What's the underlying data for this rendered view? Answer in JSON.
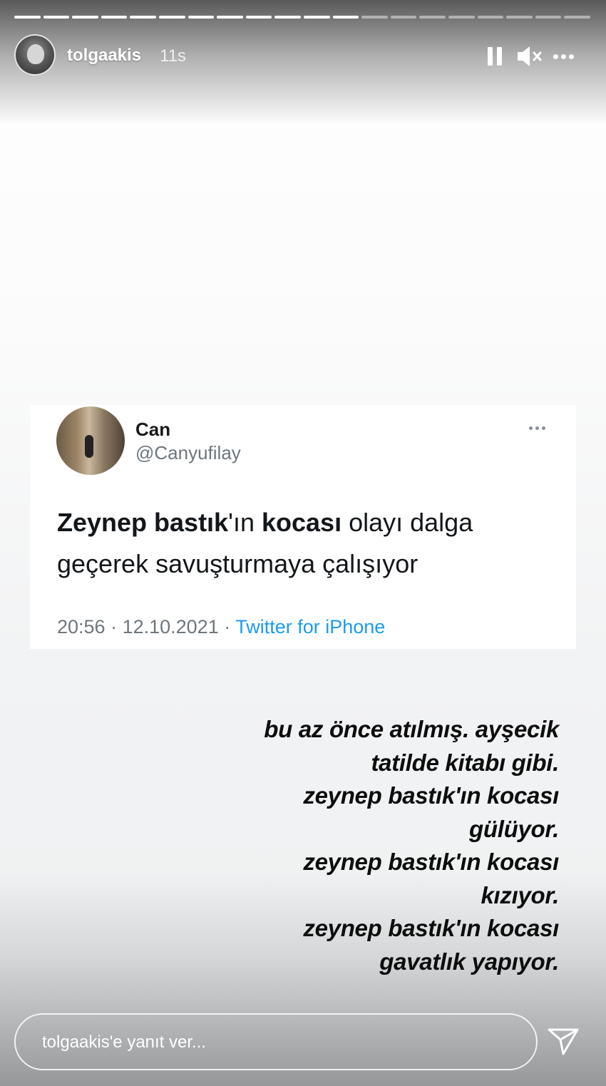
{
  "story": {
    "progress": {
      "segments": 20,
      "completed": 12
    }
  },
  "header": {
    "username": "tolgaakis",
    "time": "11s",
    "icons": [
      "pause-icon",
      "mute-icon",
      "more-icon"
    ]
  },
  "tweet": {
    "name": "Can",
    "handle": "@Canyufilay",
    "text_parts": {
      "p1": "Zeynep bastık",
      "p2": "'ın ",
      "p3": "kocası",
      "p4": " olayı dalga geçerek savuşturmaya çalışıyor"
    },
    "time": "20:56",
    "date": "12.10.2021",
    "source": "Twitter for iPhone",
    "separator": " · "
  },
  "caption": {
    "lines": [
      "bu az önce atılmış. ayşecik",
      "tatilde kitabı gibi.",
      "zeynep bastık'ın kocası",
      "gülüyor.",
      "zeynep bastık'ın kocası",
      "kızıyor.",
      "zeynep bastık'ın kocası",
      "gavatlık yapıyor."
    ]
  },
  "reply": {
    "placeholder": "tolgaakis'e yanıt ver..."
  },
  "colors": {
    "twitter_blue": "#1d9bf0",
    "muted_gray": "#6e767d"
  }
}
